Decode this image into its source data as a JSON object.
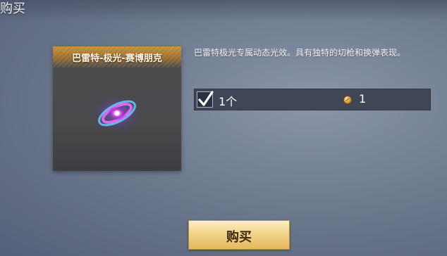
{
  "window": {
    "title": "购买"
  },
  "item": {
    "name": "巴雷特-极光-赛博朋克",
    "description": "巴雷特极光专属动态光效。具有独特的切枪和换弹表现。",
    "icon": "galaxy-effect-icon"
  },
  "option": {
    "checked": true,
    "quantity_label": "1个",
    "currency_icon": "gold-coin-icon",
    "price": "1"
  },
  "actions": {
    "buy_label": "购买"
  },
  "colors": {
    "card_header": "#c78f3a",
    "button_gold": "#f3d488",
    "row_bg": "#3f4756"
  }
}
